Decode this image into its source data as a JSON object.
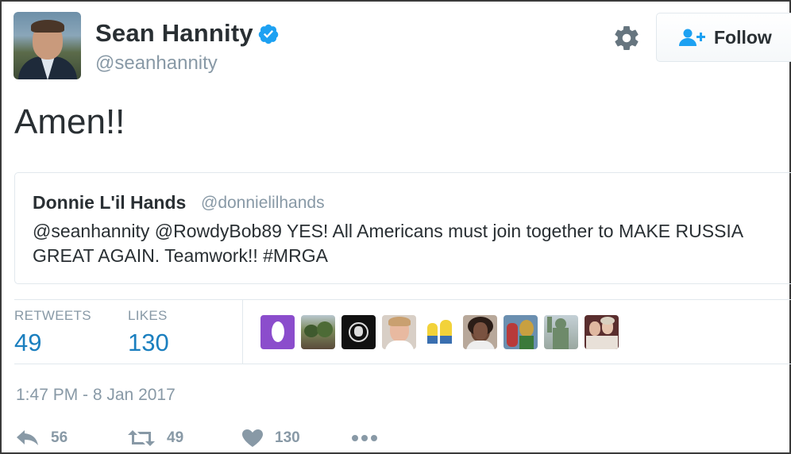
{
  "author": {
    "name": "Sean Hannity",
    "handle": "@seanhannity",
    "verified": true
  },
  "follow_button": {
    "label": "Follow"
  },
  "tweet": {
    "text": "Amen!!"
  },
  "quoted_tweet": {
    "name": "Donnie L'il Hands",
    "handle": "@donnielilhands",
    "text": "@seanhannity @RowdyBob89 YES! All Americans must join together to MAKE RUSSIA GREAT AGAIN.  Teamwork!!  #MRGA"
  },
  "stats": {
    "retweets_label": "RETWEETS",
    "retweets_value": "49",
    "likes_label": "LIKES",
    "likes_value": "130"
  },
  "likers": [
    "egg-avatar",
    "landscape-avatar",
    "skull-logo-avatar",
    "woman-avatar",
    "minions-avatar",
    "woman-portrait-avatar",
    "costume-avatar",
    "statue-avatar",
    "couple-avatar"
  ],
  "timestamp": "1:47 PM - 8 Jan 2017",
  "actions": {
    "reply_count": "56",
    "retweet_count": "49",
    "like_count": "130"
  },
  "colors": {
    "text": "#292f33",
    "muted": "#8899a6",
    "link": "#1b7fbf",
    "verified": "#1da1f2",
    "border": "#e1e8ed"
  }
}
